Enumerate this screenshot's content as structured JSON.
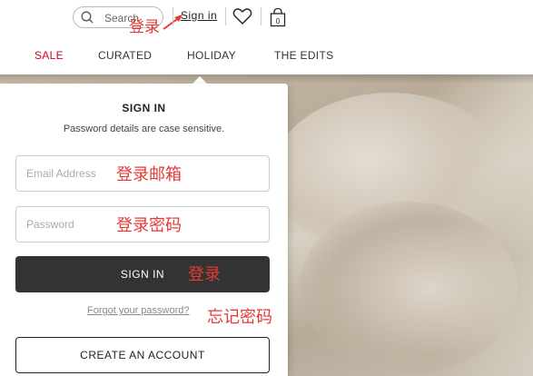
{
  "header": {
    "search_placeholder": "Search",
    "signin_label": "Sign in",
    "annotation_signin": "登录"
  },
  "nav": {
    "items": [
      {
        "label": "SALE"
      },
      {
        "label": "CURATED"
      },
      {
        "label": "HOLIDAY"
      },
      {
        "label": "THE EDITS"
      }
    ]
  },
  "panel": {
    "title": "SIGN IN",
    "subtitle": "Password details are case sensitive.",
    "email_placeholder": "Email Address",
    "password_placeholder": "Password",
    "signin_button": "SIGN IN",
    "forgot_link": "Forgot your password?",
    "create_button": "CREATE AN ACCOUNT"
  },
  "annotations": {
    "email": "登录邮箱",
    "password": "登录密码",
    "signin": "登录",
    "forgot": "忘记密码"
  },
  "colors": {
    "sale": "#d0021b",
    "annotation": "#e53935",
    "primary_button": "#333333"
  },
  "icons": {
    "search": "search-icon",
    "wishlist": "heart-icon",
    "bag": "shopping-bag-icon",
    "arrow": "arrow-icon"
  },
  "bag_count": "0"
}
